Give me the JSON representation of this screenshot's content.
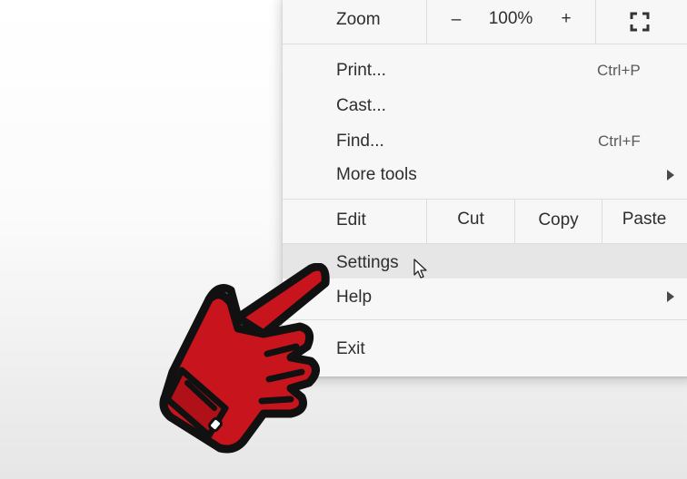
{
  "menu": {
    "zoom": {
      "label": "Zoom",
      "minus": "–",
      "value": "100%",
      "plus": "+",
      "fullscreen_icon": "fullscreen-icon"
    },
    "print": {
      "label": "Print...",
      "shortcut": "Ctrl+P"
    },
    "cast": {
      "label": "Cast..."
    },
    "find": {
      "label": "Find...",
      "shortcut": "Ctrl+F"
    },
    "more_tools": {
      "label": "More tools"
    },
    "edit": {
      "label": "Edit",
      "cut": "Cut",
      "copy": "Copy",
      "paste": "Paste"
    },
    "settings": {
      "label": "Settings"
    },
    "help": {
      "label": "Help"
    },
    "exit": {
      "label": "Exit"
    }
  },
  "overlay": {
    "pointer_icon": "red-pointing-hand-icon",
    "cursor_icon": "mouse-cursor-icon"
  },
  "colors": {
    "hand_fill": "#c8141c",
    "hand_outline": "#111111",
    "hover_row": "#e6e6e6"
  }
}
